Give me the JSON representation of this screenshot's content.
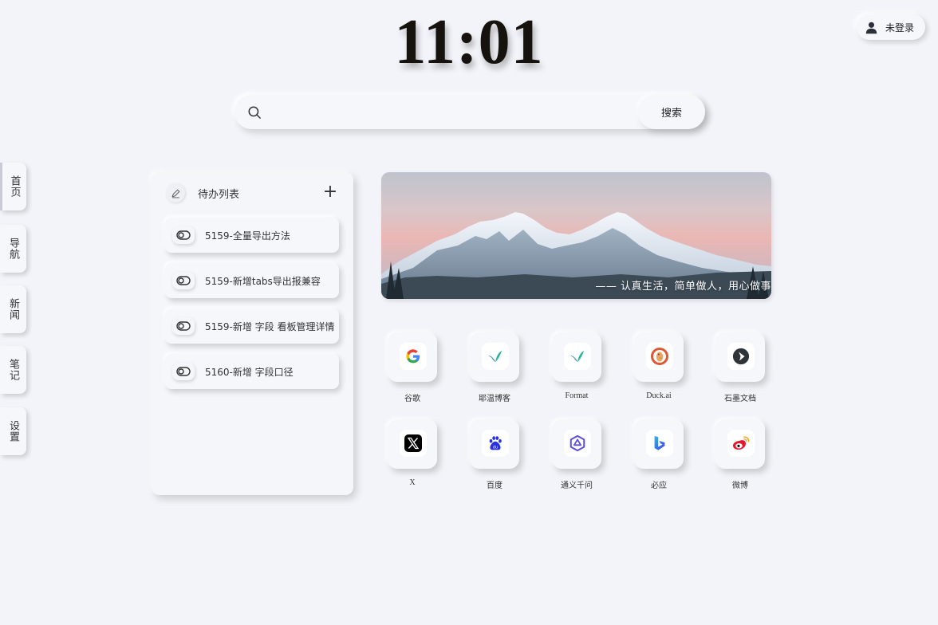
{
  "clock": {
    "time": "11:01"
  },
  "header": {
    "login_label": "未登录"
  },
  "search": {
    "placeholder": "",
    "value": "",
    "button_label": "搜索"
  },
  "sidebar": {
    "items": [
      {
        "label": "首页",
        "active": true
      },
      {
        "label": "导航"
      },
      {
        "label": "新闻"
      },
      {
        "label": "笔记"
      },
      {
        "label": "设置"
      }
    ]
  },
  "todo": {
    "title": "待办列表",
    "add_label": "+",
    "items": [
      {
        "text": "5159-全量导出方法"
      },
      {
        "text": "5159-新增tabs导出报兼容"
      },
      {
        "text": "5159-新增 字段 看板管理详情"
      },
      {
        "text": "5160-新增 字段口径"
      }
    ]
  },
  "banner": {
    "quote": "—— 认真生活，简单做人，用心做事"
  },
  "shortcuts": [
    {
      "name": "谷歌",
      "icon": "google-icon"
    },
    {
      "name": "耶温博客",
      "icon": "yewen-blog-icon"
    },
    {
      "name": "Format",
      "icon": "format-icon"
    },
    {
      "name": "Duck.ai",
      "icon": "duckduckgo-icon"
    },
    {
      "name": "石墨文档",
      "icon": "shimo-docs-icon"
    },
    {
      "name": "X",
      "icon": "x-icon"
    },
    {
      "name": "百度",
      "icon": "baidu-icon"
    },
    {
      "name": "通义千问",
      "icon": "tongyi-qianwen-icon"
    },
    {
      "name": "必应",
      "icon": "bing-icon"
    },
    {
      "name": "微博",
      "icon": "weibo-icon"
    }
  ],
  "colors": {
    "background": "#f3f4f9",
    "clock": "#16130f",
    "text": "#333333"
  }
}
